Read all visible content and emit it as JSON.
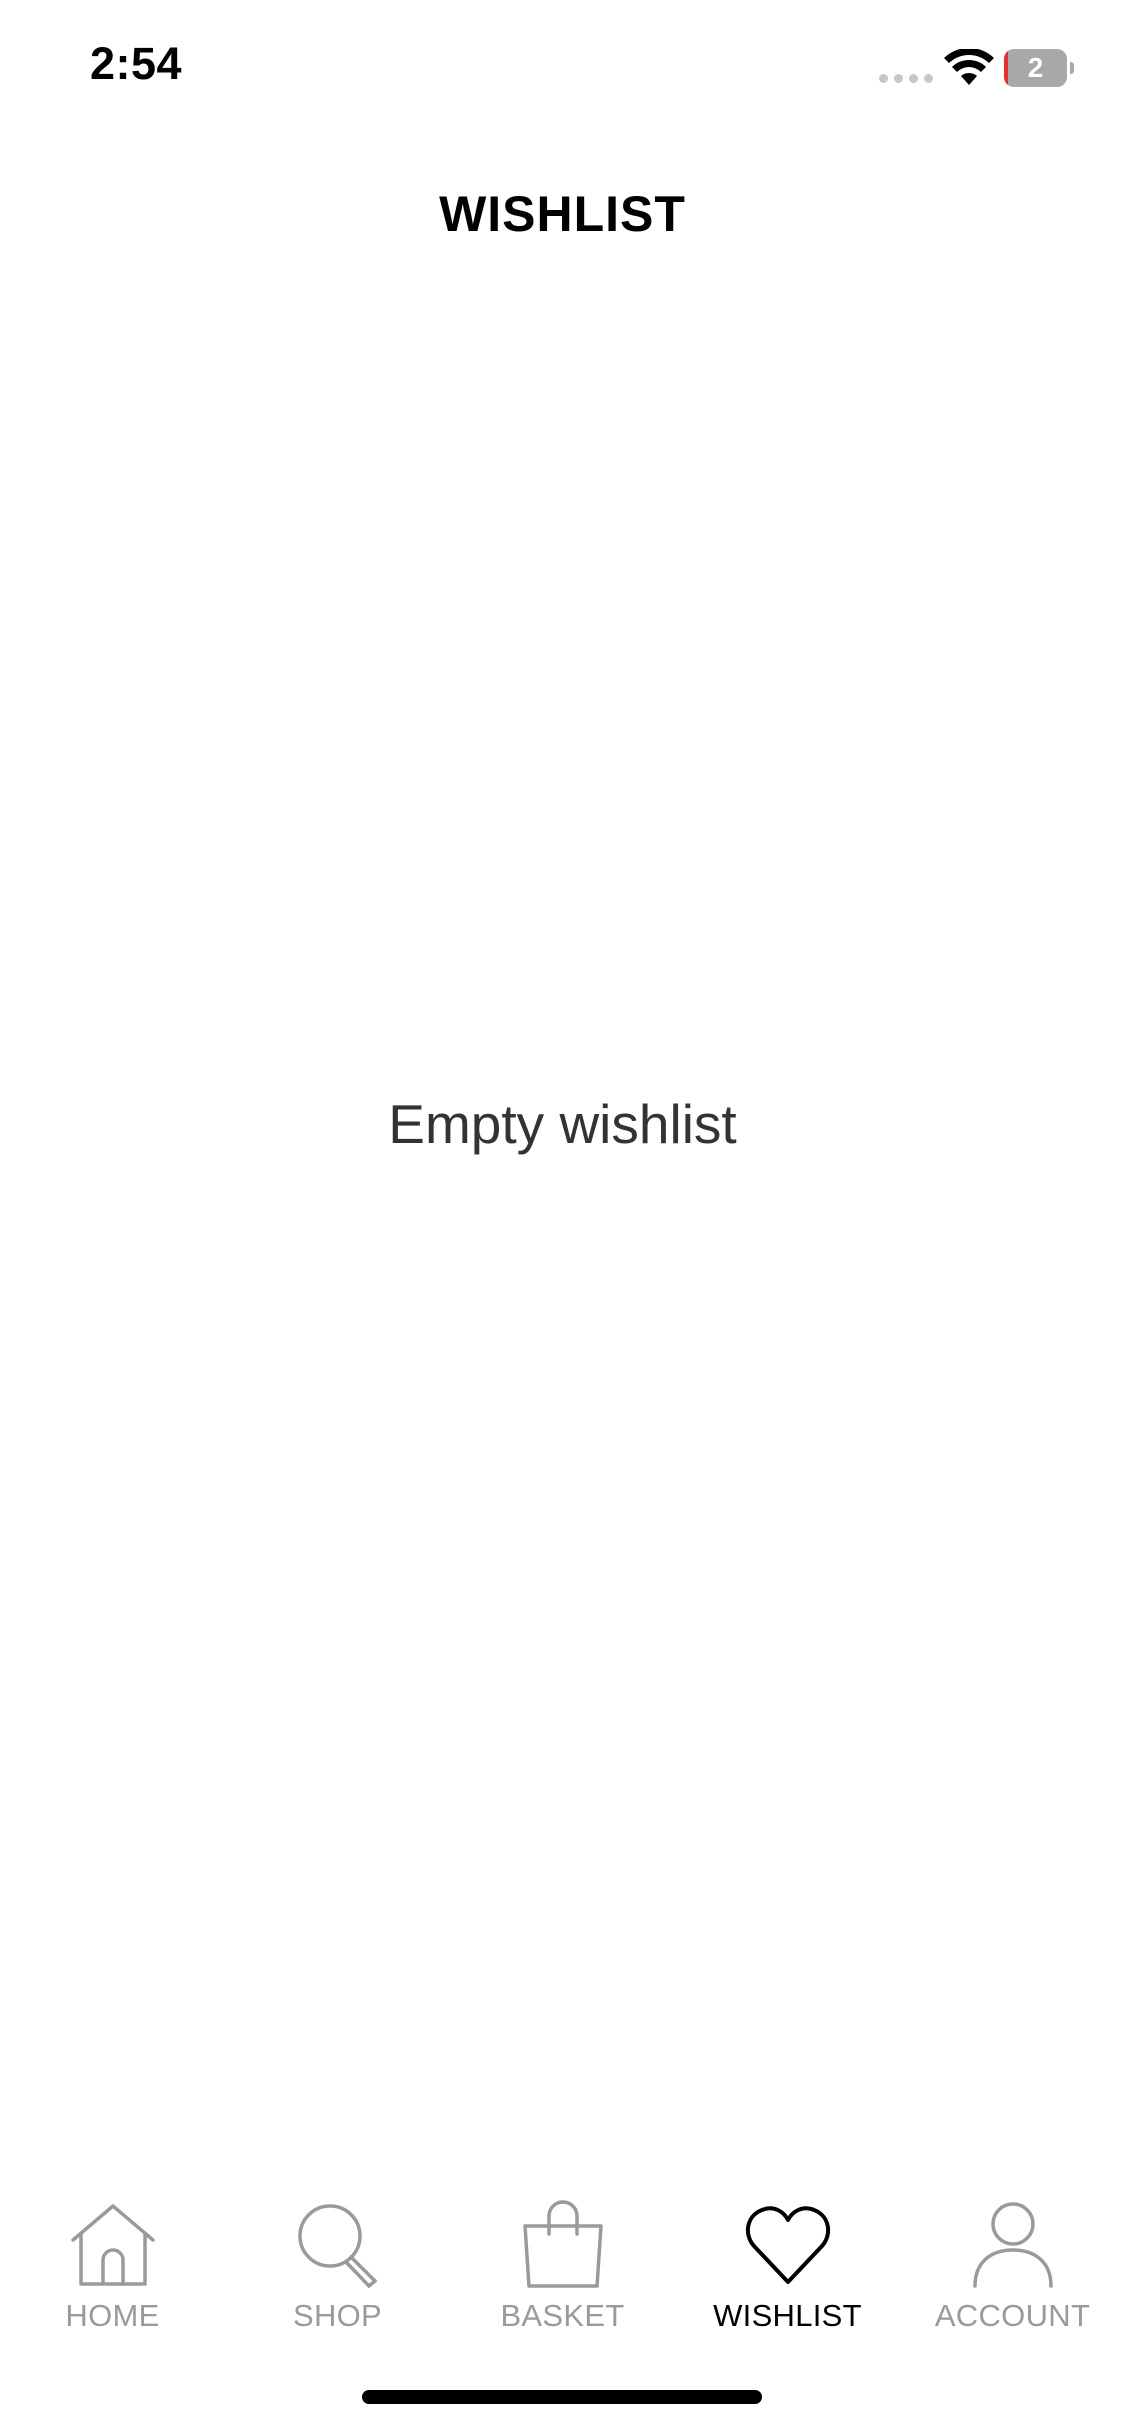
{
  "status_bar": {
    "time": "2:54",
    "battery_text": "2",
    "battery_level": 0.06,
    "battery_color": "#a8a8a8",
    "battery_low_color": "#e0302f"
  },
  "header": {
    "title": "WISHLIST"
  },
  "main": {
    "empty_message": "Empty wishlist"
  },
  "tab_bar": {
    "active_color": "#000000",
    "inactive_color": "#9a9a9a",
    "tabs": [
      {
        "label": "HOME",
        "icon": "home-icon",
        "active": false
      },
      {
        "label": "SHOP",
        "icon": "search-icon",
        "active": false
      },
      {
        "label": "BASKET",
        "icon": "shopping-bag-icon",
        "active": false
      },
      {
        "label": "WISHLIST",
        "icon": "heart-icon",
        "active": true
      },
      {
        "label": "ACCOUNT",
        "icon": "user-icon",
        "active": false
      }
    ]
  }
}
